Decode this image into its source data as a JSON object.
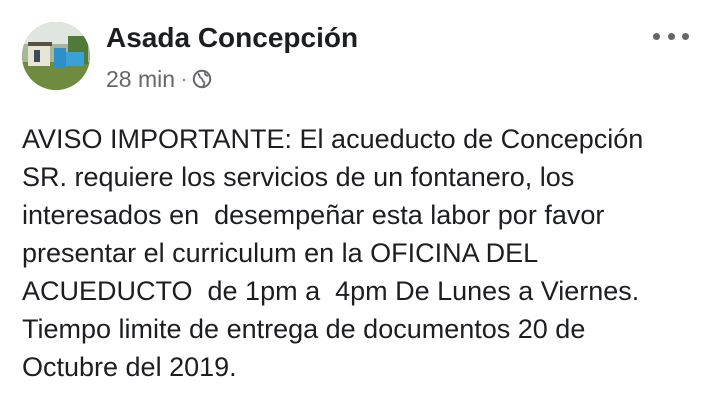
{
  "post": {
    "author": "Asada Concepción",
    "time": "28 min",
    "separator": "·",
    "audience_icon": "globe-icon",
    "more_icon": "more-options-icon",
    "lines": [
      "AVISO IMPORTANTE: El acueducto de Concepción",
      "SR. requiere los servicios de un fontanero, los",
      "interesados en  desempeñar esta labor por favor",
      "presentar el curriculum en la OFICINA DEL",
      "ACUEDUCTO  de 1pm a  4pm De Lunes a Viernes.",
      "Tiempo limite de entrega de documentos 20 de",
      "Octubre del 2019."
    ]
  },
  "colors": {
    "text": "#1c1e21",
    "secondary": "#65676b",
    "background": "#ffffff"
  }
}
